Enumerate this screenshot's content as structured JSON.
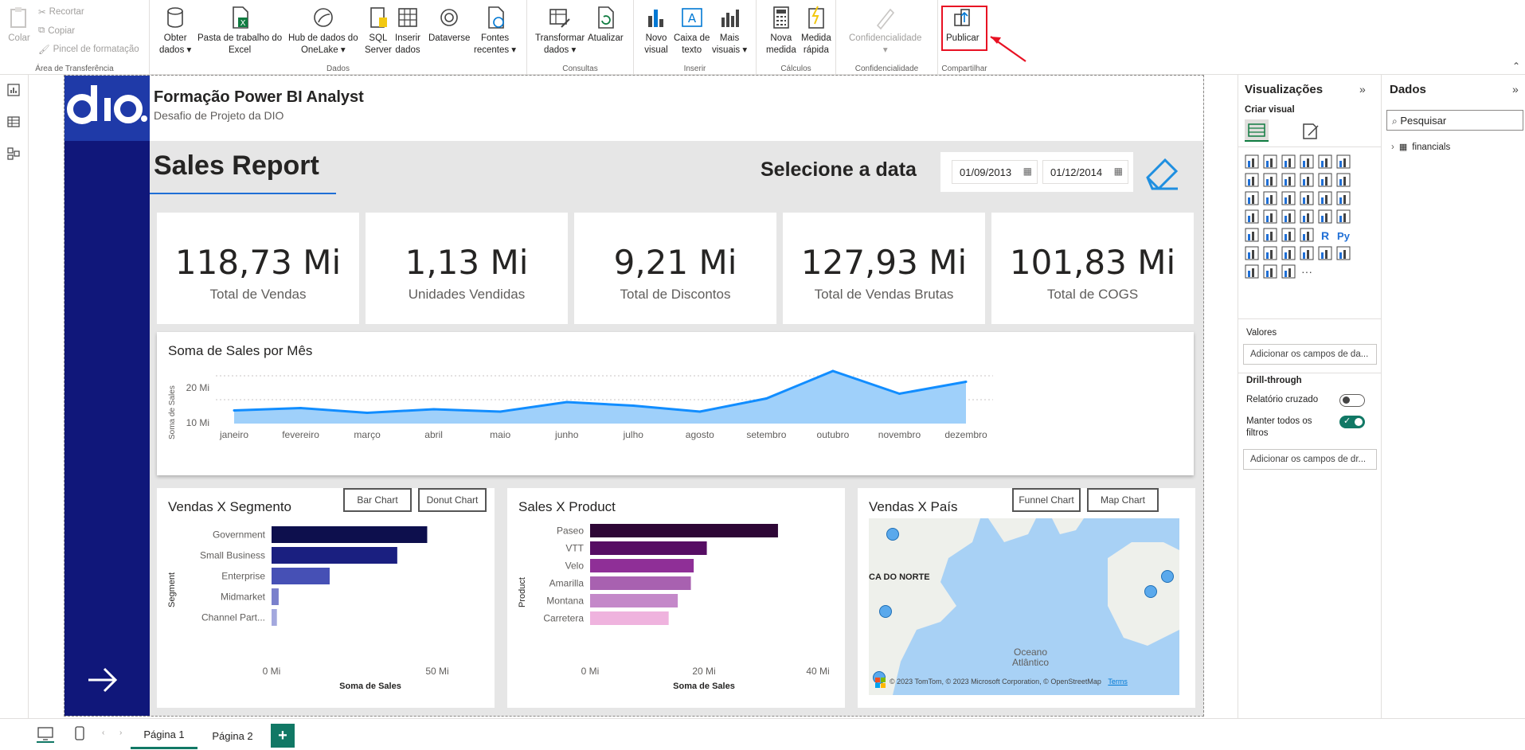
{
  "ribbon": {
    "clipboard": {
      "paste": "Colar",
      "cut": "Recortar",
      "copy": "Copiar",
      "format_painter": "Pincel de formatação",
      "label": "Área de Transferência"
    },
    "data": {
      "label": "Dados",
      "get_data": "Obter\ndados ▾",
      "excel": "Pasta de trabalho do\nExcel",
      "onelake": "Hub de dados do\nOneLake ▾",
      "sql": "SQL\nServer",
      "enter_data": "Inserir\ndados",
      "dataverse": "Dataverse",
      "recent": "Fontes\nrecentes ▾"
    },
    "queries": {
      "label": "Consultas",
      "transform": "Transformar\ndados ▾",
      "refresh": "Atualizar"
    },
    "insert": {
      "label": "Inserir",
      "new_visual": "Novo\nvisual",
      "text_box": "Caixa de\ntexto",
      "more_visuals": "Mais\nvisuais ▾"
    },
    "calc": {
      "label": "Cálculos",
      "new_measure": "Nova\nmedida",
      "quick_measure": "Medida\nrápida"
    },
    "sensitivity": {
      "label": "Confidencialidade",
      "button": "Confidencialidade\n▾"
    },
    "share": {
      "label": "Compartilhar",
      "publish": "Publicar"
    }
  },
  "report": {
    "title": "Formação Power BI Analyst",
    "subtitle": "Desafio de Projeto da DIO",
    "heading": "Sales Report",
    "date_prompt": "Selecione a data",
    "date_start": "01/09/2013",
    "date_end": "01/12/2014",
    "kpis": [
      {
        "value": "118,73 Mi",
        "label": "Total de Vendas"
      },
      {
        "value": "1,13 Mi",
        "label": "Unidades Vendidas"
      },
      {
        "value": "9,21 Mi",
        "label": "Total de Discontos"
      },
      {
        "value": "127,93 Mi",
        "label": "Total de Vendas Brutas"
      },
      {
        "value": "101,83 Mi",
        "label": "Total de COGS"
      }
    ],
    "line_chart": {
      "title": "Soma de Sales por Mês",
      "ylabel": "Soma de Sales",
      "yticks": [
        "20 Mi",
        "10 Mi"
      ]
    },
    "segment_chart": {
      "title": "Vendas X Segmento",
      "bar_btn": "Bar Chart",
      "donut_btn": "Donut Chart",
      "ylabel": "Segment",
      "xlabel": "Soma de Sales",
      "xticks": [
        "0 Mi",
        "50 Mi"
      ]
    },
    "product_chart": {
      "title": "Sales X Product",
      "ylabel": "Product",
      "xlabel": "Soma de Sales",
      "xticks": [
        "0 Mi",
        "20 Mi",
        "40 Mi"
      ]
    },
    "map": {
      "title": "Vendas X País",
      "funnel_btn": "Funnel Chart",
      "map_btn": "Map Chart",
      "label_na": "CA DO NORTE",
      "label_ocean": "Oceano\nAtlântico",
      "attribution": "© 2023 TomTom, © 2023 Microsoft Corporation, © OpenStreetMap",
      "terms": "Terms"
    }
  },
  "chart_data": [
    {
      "type": "area",
      "title": "Soma de Sales por Mês",
      "xlabel": "",
      "ylabel": "Soma de Sales",
      "categories": [
        "janeiro",
        "fevereiro",
        "março",
        "abril",
        "maio",
        "junho",
        "julho",
        "agosto",
        "setembro",
        "outubro",
        "novembro",
        "dezembro"
      ],
      "values": [
        5.5,
        6.5,
        4.5,
        6.0,
        5.0,
        9.0,
        7.5,
        5.0,
        10.5,
        22.0,
        12.5,
        17.5
      ],
      "ylim": [
        0,
        25
      ],
      "color": "#118dff"
    },
    {
      "type": "bar",
      "title": "Vendas X Segmento",
      "xlabel": "Soma de Sales",
      "ylabel": "Segment",
      "categories": [
        "Government",
        "Small Business",
        "Enterprise",
        "Midmarket",
        "Channel Part..."
      ],
      "values": [
        52.5,
        42.4,
        19.6,
        2.4,
        1.8
      ],
      "xlim": [
        0,
        65
      ],
      "colors": [
        "#0d0f4d",
        "#1a1f80",
        "#4650b5",
        "#7a80cc",
        "#a3a8de"
      ]
    },
    {
      "type": "bar",
      "title": "Sales X Product",
      "xlabel": "Soma de Sales",
      "ylabel": "Product",
      "categories": [
        "Paseo",
        "VTT",
        "Velo",
        "Amarilla",
        "Montana",
        "Carretera"
      ],
      "values": [
        33.0,
        20.5,
        18.2,
        17.7,
        15.4,
        13.8
      ],
      "xlim": [
        0,
        40
      ],
      "colors": [
        "#2e0736",
        "#560d63",
        "#8f2f97",
        "#a861b0",
        "#c488c9",
        "#efb3de"
      ]
    }
  ],
  "viz_pane": {
    "title": "Visualizações",
    "create": "Criar visual",
    "values": "Valores",
    "values_well": "Adicionar os campos de da...",
    "drill": "Drill-through",
    "cross": "Relatório cruzado",
    "keep": "Manter todos os\nfiltros",
    "drill_well": "Adicionar os campos de dr..."
  },
  "data_pane": {
    "title": "Dados",
    "search": "Pesquisar",
    "table": "financials"
  },
  "pages": {
    "p1": "Página 1",
    "p2": "Página 2",
    "add": "+"
  }
}
